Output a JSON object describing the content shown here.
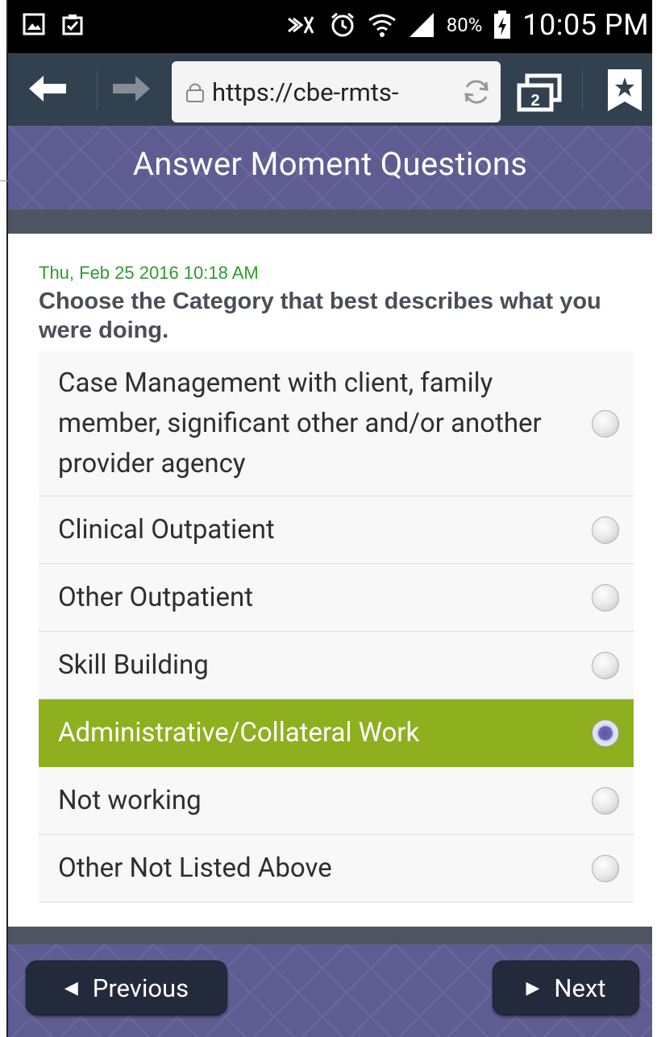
{
  "status_bar": {
    "battery_percent": "80%",
    "time": "10:05 PM"
  },
  "browser": {
    "url": "https://cbe-rmts-",
    "tab_count": "2"
  },
  "header": {
    "title": "Answer Moment Questions"
  },
  "moment": {
    "timestamp": "Thu, Feb 25 2016 10:18 AM",
    "question": "Choose the Category that best describes what you were doing."
  },
  "options": [
    {
      "label": "Case Management with client, family member, significant other and/or another provider agency",
      "selected": false
    },
    {
      "label": "Clinical Outpatient",
      "selected": false
    },
    {
      "label": "Other Outpatient",
      "selected": false
    },
    {
      "label": "Skill Building",
      "selected": false
    },
    {
      "label": "Administrative/Collateral Work",
      "selected": true
    },
    {
      "label": "Not working",
      "selected": false
    },
    {
      "label": "Other Not Listed Above",
      "selected": false
    }
  ],
  "footer": {
    "previous_label": "Previous",
    "next_label": "Next"
  },
  "colors": {
    "header_purple": "#5e5c91",
    "toolbar": "#32414f",
    "selected_green": "#8eb01f",
    "timestamp_green": "#2f9a2f"
  }
}
